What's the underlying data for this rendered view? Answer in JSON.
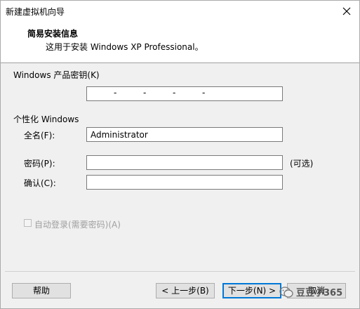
{
  "window": {
    "title": "新建虚拟机向导"
  },
  "header": {
    "title": "简易安装信息",
    "subtitle": "这用于安装 Windows XP Professional。"
  },
  "product_key": {
    "label": "Windows 产品密钥(K)",
    "value": "",
    "separators": [
      "-",
      "-",
      "-",
      "-"
    ]
  },
  "personalize": {
    "section_label": "个性化 Windows",
    "full_name_label": "全名(F):",
    "full_name_value": "Administrator",
    "password_label": "密码(P):",
    "password_value": "",
    "optional_note": "(可选)",
    "confirm_label": "确认(C):",
    "confirm_value": ""
  },
  "auto_login": {
    "label": "自动登录(需要密码)(A)",
    "checked": false,
    "enabled": false
  },
  "buttons": {
    "help": "帮助",
    "back": "< 上一步(B)",
    "next": "下一步(N) >",
    "cancel": "取消"
  },
  "watermark": {
    "text": "豆豆小365"
  },
  "colors": {
    "primary_border": "#0078d7",
    "header_bg": "#ffffff",
    "dialog_bg": "#f0f0f0"
  }
}
